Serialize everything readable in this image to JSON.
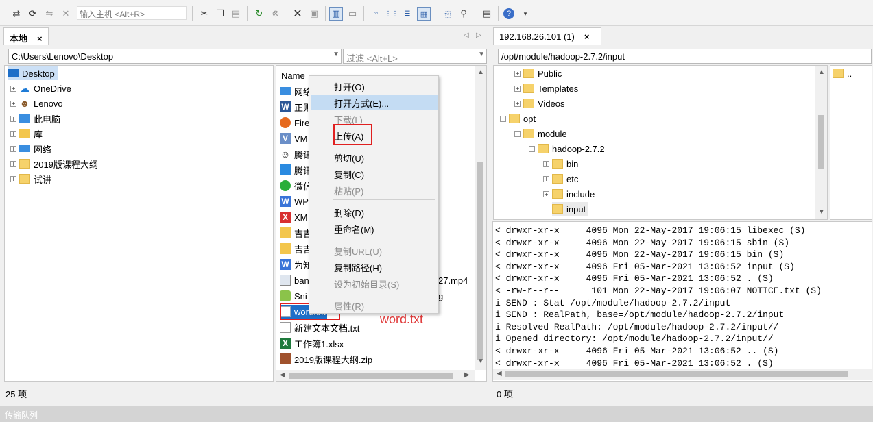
{
  "toolbar": {
    "host_placeholder": "输入主机 <Alt+R>"
  },
  "local": {
    "tab_label": "本地",
    "tab_close": "×",
    "path": "C:\\Users\\Lenovo\\Desktop",
    "filter_placeholder": "过滤 <Alt+L>",
    "nav": {
      "prev": "◁",
      "next": "▷"
    },
    "tree": [
      {
        "label": "Desktop"
      },
      {
        "label": "OneDrive"
      },
      {
        "label": "Lenovo"
      },
      {
        "label": "此电脑"
      },
      {
        "label": "库"
      },
      {
        "label": "网络"
      },
      {
        "label": "2019版课程大纲"
      },
      {
        "label": "试讲"
      }
    ],
    "column_name": "Name",
    "files": [
      "网络",
      "正则",
      "Fire",
      "VM",
      "腾讯",
      "腾讯",
      "微信",
      "WP",
      "XM",
      "吉吉",
      "吉吉",
      "为知",
      "ban",
      "Sni",
      "word.txt",
      "新建文本文档.txt",
      "工作簿1.xlsx",
      "2019版课程大纲.zip"
    ],
    "file_tail_mp4": "27.mp4",
    "file_tail_g": "g",
    "status": "25 项"
  },
  "remote": {
    "tab_label": "192.168.26.101 (1)",
    "tab_close": "×",
    "path": "/opt/module/hadoop-2.7.2/input",
    "tree": [
      {
        "label": "Public"
      },
      {
        "label": "Templates"
      },
      {
        "label": "Videos"
      },
      {
        "label": "opt"
      },
      {
        "label": "module"
      },
      {
        "label": "hadoop-2.7.2"
      },
      {
        "label": "bin"
      },
      {
        "label": "etc"
      },
      {
        "label": "include"
      },
      {
        "label": "input"
      }
    ],
    "list_item": "..",
    "log": [
      "< drwxr-xr-x     4096 Mon 22-May-2017 19:06:15 libexec (S)",
      "< drwxr-xr-x     4096 Mon 22-May-2017 19:06:15 sbin (S)",
      "< drwxr-xr-x     4096 Mon 22-May-2017 19:06:15 bin (S)",
      "< drwxr-xr-x     4096 Fri 05-Mar-2021 13:06:52 input (S)",
      "< drwxr-xr-x     4096 Fri 05-Mar-2021 13:06:52 . (S)",
      "< -rw-r--r--      101 Mon 22-May-2017 19:06:07 NOTICE.txt (S)",
      "i SEND : Stat /opt/module/hadoop-2.7.2/input",
      "i SEND : RealPath, base=/opt/module/hadoop-2.7.2/input",
      "i Resolved RealPath: /opt/module/hadoop-2.7.2/input//",
      "i Opened directory: /opt/module/hadoop-2.7.2/input//",
      "< drwxr-xr-x     4096 Fri 05-Mar-2021 13:06:52 .. (S)",
      "< drwxr-xr-x     4096 Fri 05-Mar-2021 13:06:52 . (S)"
    ],
    "status": "0 项"
  },
  "context_menu": {
    "items": [
      "打开(O)",
      "打开方式(E)...",
      "下载(L)",
      "上传(A)",
      "剪切(U)",
      "复制(C)",
      "粘贴(P)",
      "删除(D)",
      "重命名(M)",
      "复制URL(U)",
      "复制路径(H)",
      "设为初始目录(S)",
      "属性(R)"
    ]
  },
  "annotation": "word.txt",
  "transfer_queue": "传输队列"
}
